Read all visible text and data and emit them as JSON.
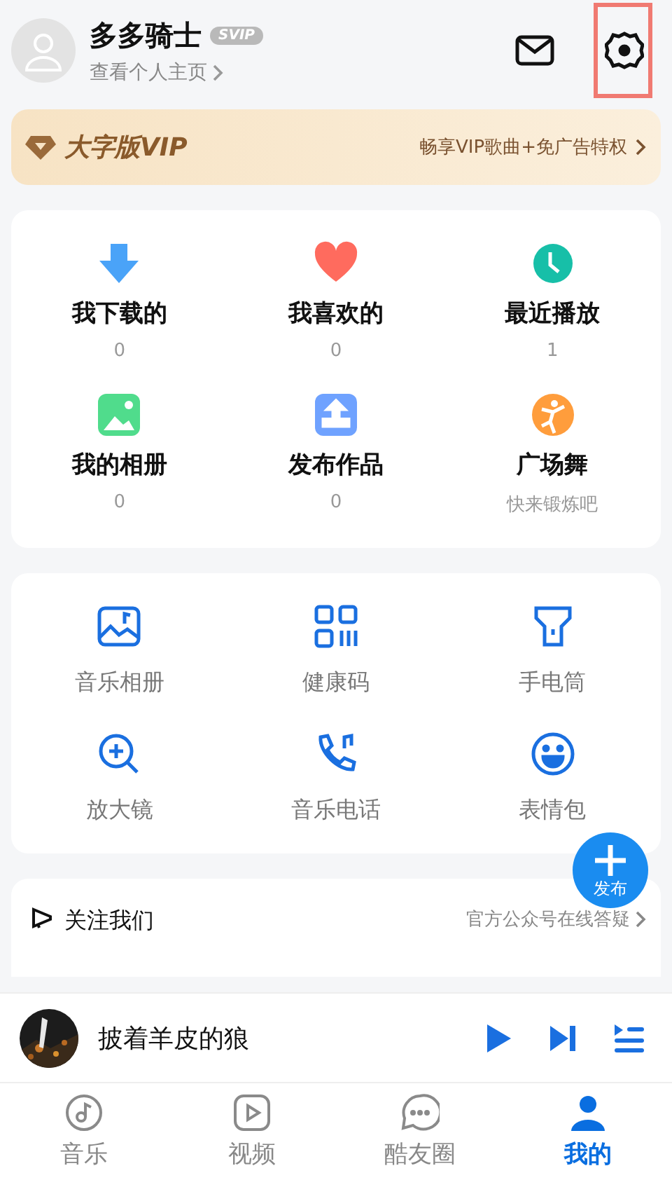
{
  "profile": {
    "name": "多多骑士",
    "badge": "SVIP",
    "link": "查看个人主页",
    "settings_highlighted": true
  },
  "vip_banner": {
    "title": "大字版VIP",
    "promo": "畅享VIP歌曲+免广告特权"
  },
  "my_items": [
    {
      "kind": "download",
      "label": "我下载的",
      "sub": "0"
    },
    {
      "kind": "heart",
      "label": "我喜欢的",
      "sub": "0"
    },
    {
      "kind": "clock",
      "label": "最近播放",
      "sub": "1"
    },
    {
      "kind": "album",
      "label": "我的相册",
      "sub": "0"
    },
    {
      "kind": "upload",
      "label": "发布作品",
      "sub": "0"
    },
    {
      "kind": "dance",
      "label": "广场舞",
      "sub": "快来锻炼吧"
    }
  ],
  "tools": [
    {
      "kind": "music-album",
      "label": "音乐相册"
    },
    {
      "kind": "qr",
      "label": "健康码"
    },
    {
      "kind": "flashlight",
      "label": "手电筒"
    },
    {
      "kind": "magnifier",
      "label": "放大镜"
    },
    {
      "kind": "phone",
      "label": "音乐电话"
    },
    {
      "kind": "smile",
      "label": "表情包"
    }
  ],
  "follow": {
    "title": "关注我们",
    "hint": "官方公众号在线答疑"
  },
  "fab": {
    "label": "发布"
  },
  "player": {
    "song": "披着羊皮的狼"
  },
  "tabs": [
    {
      "kind": "music",
      "label": "音乐",
      "selected": false
    },
    {
      "kind": "video",
      "label": "视频",
      "selected": false
    },
    {
      "kind": "chat",
      "label": "酷友圈",
      "selected": false
    },
    {
      "kind": "me",
      "label": "我的",
      "selected": true
    }
  ]
}
